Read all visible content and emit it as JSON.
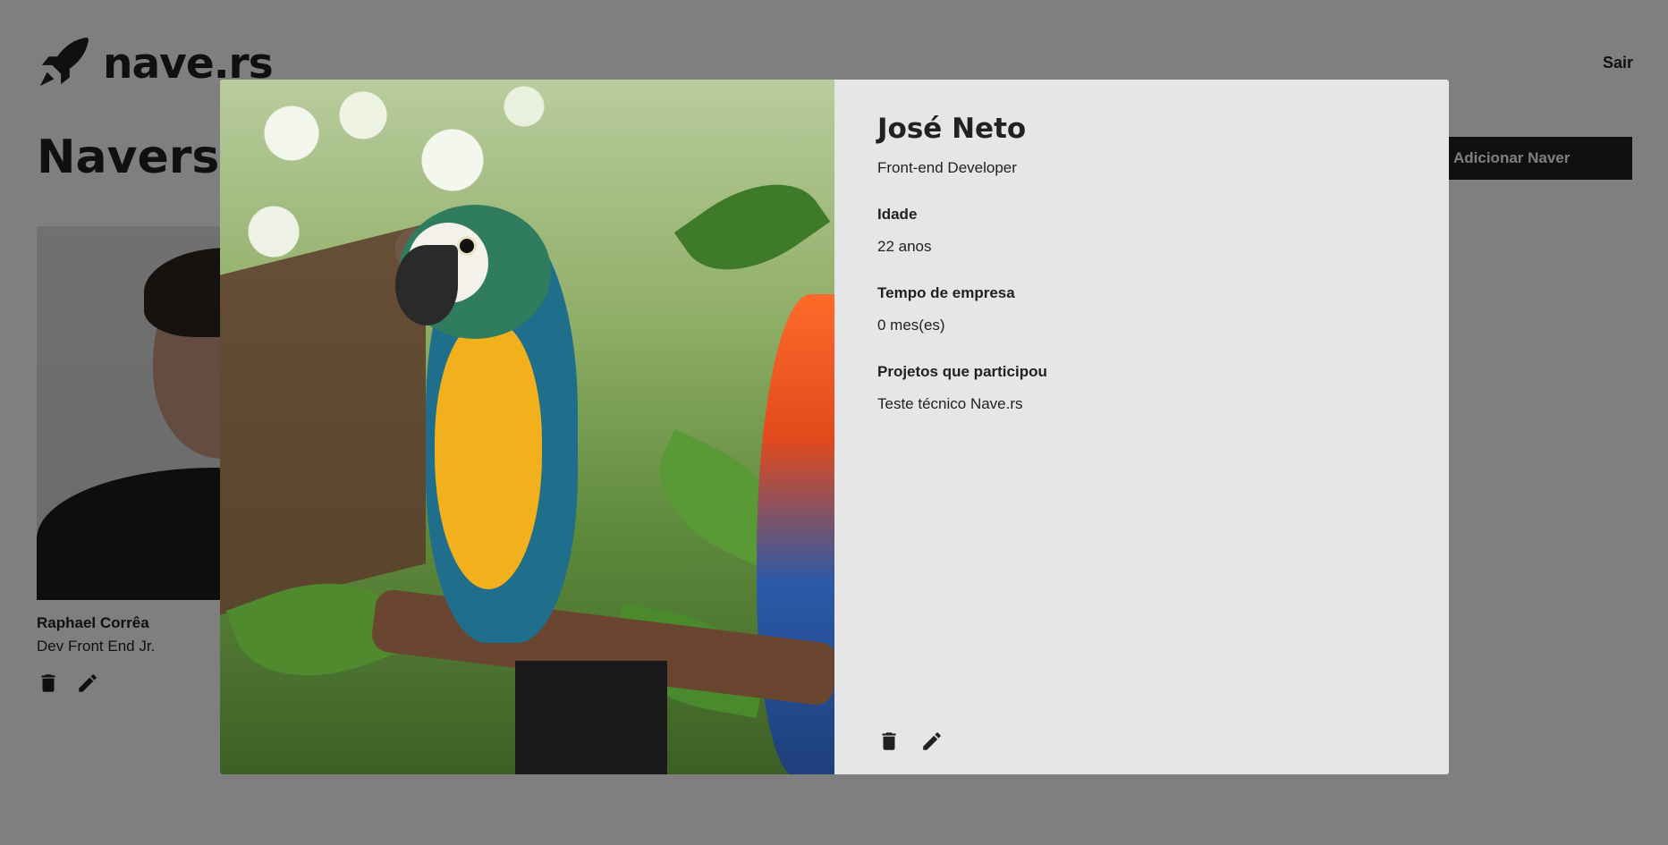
{
  "header": {
    "brand": "nave.rs",
    "logout": "Sair"
  },
  "page": {
    "title": "Navers",
    "add_button": "Adicionar Naver"
  },
  "cards": [
    {
      "name": "Raphael Corrêa",
      "role": "Dev Front End Jr."
    }
  ],
  "modal": {
    "name": "José Neto",
    "role": "Front-end Developer",
    "fields": [
      {
        "label": "Idade",
        "value": "22 anos"
      },
      {
        "label": "Tempo de empresa",
        "value": "0 mes(es)"
      },
      {
        "label": "Projetos que participou",
        "value": "Teste técnico Nave.rs"
      }
    ]
  },
  "icons": {
    "delete": "trash-icon",
    "edit": "pencil-icon",
    "logo": "rocket-icon"
  }
}
